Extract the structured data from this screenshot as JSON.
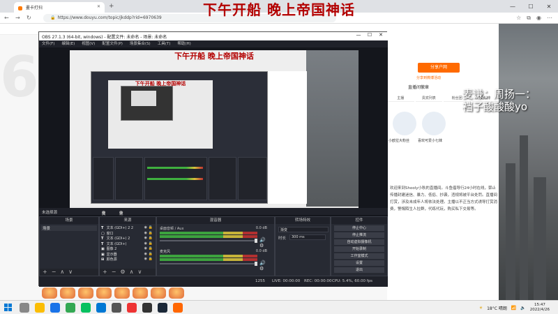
{
  "overlay_title": "下午开船 晚上帝国神话",
  "browser": {
    "tab_title": "畫卡打扫",
    "url": "https://www.douyu.com/topic/jkddp?rid=6970639"
  },
  "streamer_text": {
    "line1": "麦谦：周扬一：",
    "line2": "裆子酸酸酸yo"
  },
  "right_panel": {
    "button": "分享户网",
    "link": "分享到微博活动",
    "title": "直播间徽章",
    "tabs": [
      "主播",
      "贵宾列表",
      "粉丝团",
      "贡献排"
    ],
    "fig1": "小欧拉大粉丝",
    "fig2": "喜欢可爱小七妹",
    "text": "欢迎来到Shooly小秋的直播间。斗鱼倡导行24小时在线，禁止传播封建迷信、暴力、低俗、抄袭，违规将被平台处罚。直播间打赏，涉及未成年人将依法处理。主播以不正当方式诱导打赏消费，警惕陌生人拉群，代练代玩，购买私下交易等。"
  },
  "obs": {
    "window_title": "OBS 27.1.3 (64-bit, windows) - 配置文件: 未命名 - 场景: 未命名",
    "menu": [
      "文件(F)",
      "编辑(E)",
      "视图(V)",
      "配置文件(P)",
      "场景集合(S)",
      "工具(T)",
      "帮助(H)"
    ],
    "canvas_title": "下午开船 晚上帝国神话",
    "inner_title": "下午开船 晚上帝国神话",
    "scene_tabs": {
      "left": "未选择源",
      "props": "属性",
      "filters": "滤镜"
    },
    "docks": {
      "scenes": {
        "header": "场景",
        "item": "场景"
      },
      "sources": {
        "header": "来源",
        "items": [
          {
            "icon": "T",
            "label": "文本 (GDI+) 2 2"
          },
          {
            "icon": "▢",
            "label": "窗口"
          },
          {
            "icon": "T",
            "label": "文本 (GDI+) 2"
          },
          {
            "icon": "T",
            "label": "文本 (GDI+)"
          },
          {
            "icon": "▣",
            "label": "图像 2"
          },
          {
            "icon": "▣",
            "label": "显示器"
          },
          {
            "icon": "⊞",
            "label": "颜色源"
          }
        ]
      },
      "mixer": {
        "header": "混音器",
        "channels": [
          {
            "name": "桌面音频 / Aux",
            "db": "0.0 dB"
          },
          {
            "name": "麦克风",
            "db": "0.0 dB"
          }
        ]
      },
      "transitions": {
        "header": "转场特效",
        "type_value": "渐变",
        "duration_label": "时长",
        "duration_value": "300 ms"
      },
      "controls": {
        "header": "控件",
        "buttons": [
          "停止中心",
          "停止推流",
          "自动虚拟摄像机",
          "开始录制",
          "工作室模式",
          "设置",
          "退出"
        ]
      }
    },
    "status": {
      "live": "LIVE: 00:00:00",
      "fps_label": "1255",
      "rec": "REC: 00:00:00",
      "cpu": "CPU: 5.4%, 60.00 fps"
    }
  },
  "taskbar": {
    "temp": "18°C 晴朗",
    "time": "15:47",
    "date": "2022/4/26"
  }
}
